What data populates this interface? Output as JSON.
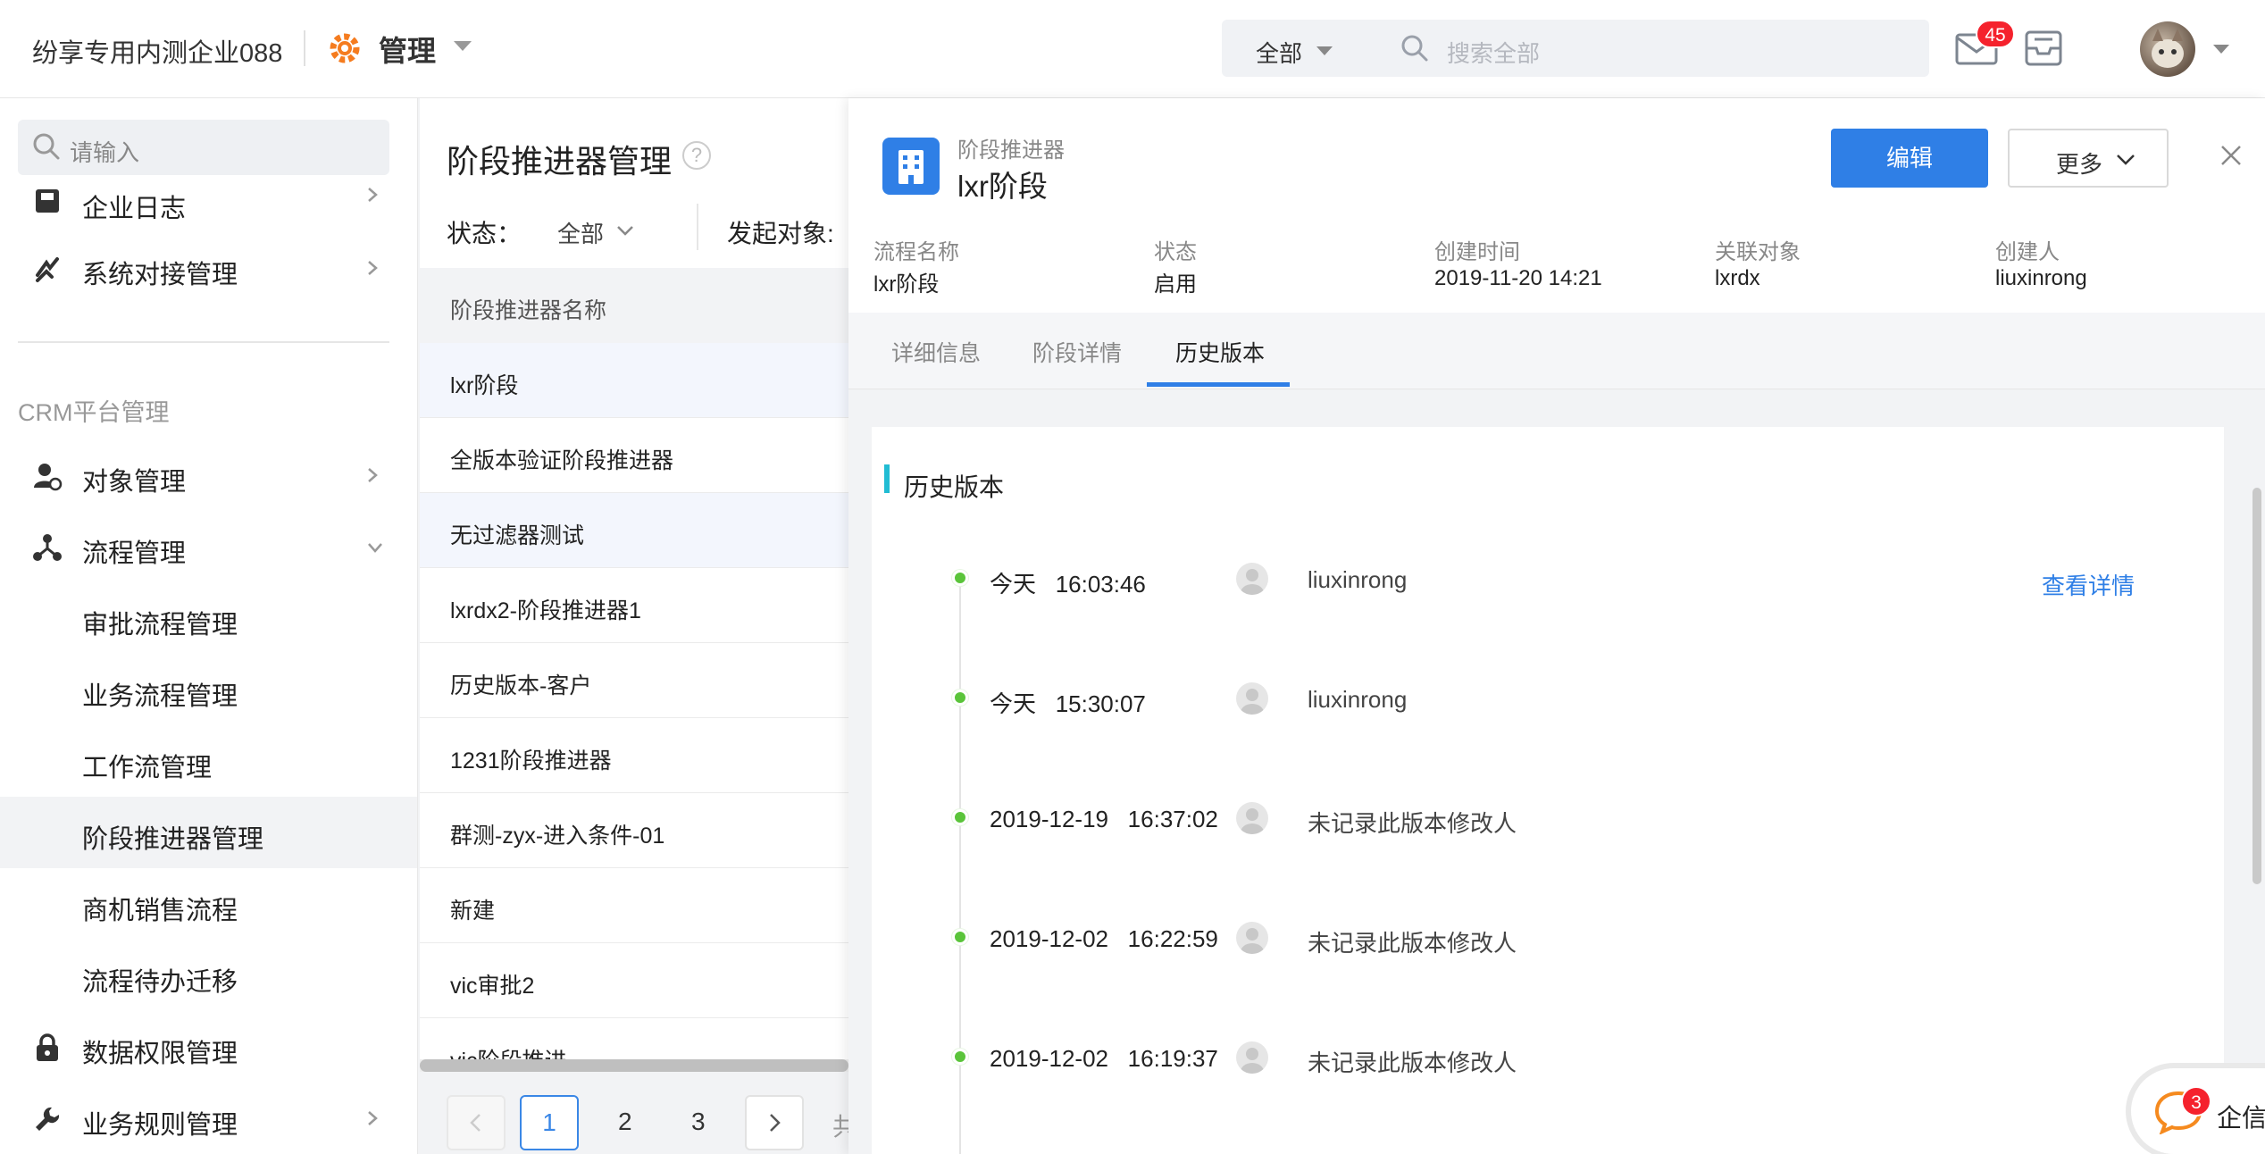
{
  "header": {
    "company": "纷享专用内测企业088",
    "app_title": "管理",
    "search_scope": "全部",
    "search_placeholder": "搜索全部",
    "mail_badge": "45"
  },
  "sidebar": {
    "search_placeholder": "请输入",
    "items_top": [
      {
        "label": "企业日志"
      },
      {
        "label": "系统对接管理"
      }
    ],
    "group_title": "CRM平台管理",
    "items": [
      {
        "label": "对象管理"
      },
      {
        "label": "流程管理"
      }
    ],
    "sub_items": [
      {
        "label": "审批流程管理"
      },
      {
        "label": "业务流程管理"
      },
      {
        "label": "工作流管理"
      },
      {
        "label": "阶段推进器管理"
      },
      {
        "label": "商机销售流程"
      },
      {
        "label": "流程待办迁移"
      }
    ],
    "items_bottom": [
      {
        "label": "数据权限管理"
      },
      {
        "label": "业务规则管理"
      }
    ]
  },
  "list": {
    "title": "阶段推进器管理",
    "filter_status_label": "状态：",
    "filter_status_value": "全部",
    "filter_object_label": "发起对象:",
    "column_header": "阶段推进器名称",
    "rows": [
      "lxr阶段",
      "全版本验证阶段推进器",
      "无过滤器测试",
      "lxrdx2-阶段推进器1",
      "历史版本-客户",
      "1231阶段推进器",
      "群测-zyx-进入条件-01",
      "新建",
      "vic审批2",
      "vic阶段推进"
    ],
    "pagination": {
      "pages": [
        "1",
        "2",
        "3"
      ],
      "current": "1",
      "trailing": "共"
    }
  },
  "detail": {
    "subtitle": "阶段推进器",
    "title": "lxr阶段",
    "edit_label": "编辑",
    "more_label": "更多",
    "info": [
      {
        "label": "流程名称",
        "value": "lxr阶段"
      },
      {
        "label": "状态",
        "value": "启用"
      },
      {
        "label": "创建时间",
        "value": "2019-11-20 14:21"
      },
      {
        "label": "关联对象",
        "value": "lxrdx"
      },
      {
        "label": "创建人",
        "value": "liuxinrong"
      }
    ],
    "tabs": [
      {
        "label": "详细信息"
      },
      {
        "label": "阶段详情"
      },
      {
        "label": "历史版本"
      }
    ],
    "active_tab": "历史版本",
    "section_title": "历史版本",
    "history": [
      {
        "date": "今天",
        "time": "16:03:46",
        "user": "liuxinrong",
        "link": "查看详情"
      },
      {
        "date": "今天",
        "time": "15:30:07",
        "user": "liuxinrong"
      },
      {
        "date": "2019-12-19",
        "time": "16:37:02",
        "user": "未记录此版本修改人"
      },
      {
        "date": "2019-12-02",
        "time": "16:22:59",
        "user": "未记录此版本修改人"
      },
      {
        "date": "2019-12-02",
        "time": "16:19:37",
        "user": "未记录此版本修改人"
      }
    ]
  },
  "qixin": {
    "label": "企信",
    "badge": "3"
  },
  "colors": {
    "accent": "#2f7fe6",
    "badge": "#f5222d",
    "timeline_dot": "#5ac43a",
    "section_bar": "#21bcd3"
  }
}
